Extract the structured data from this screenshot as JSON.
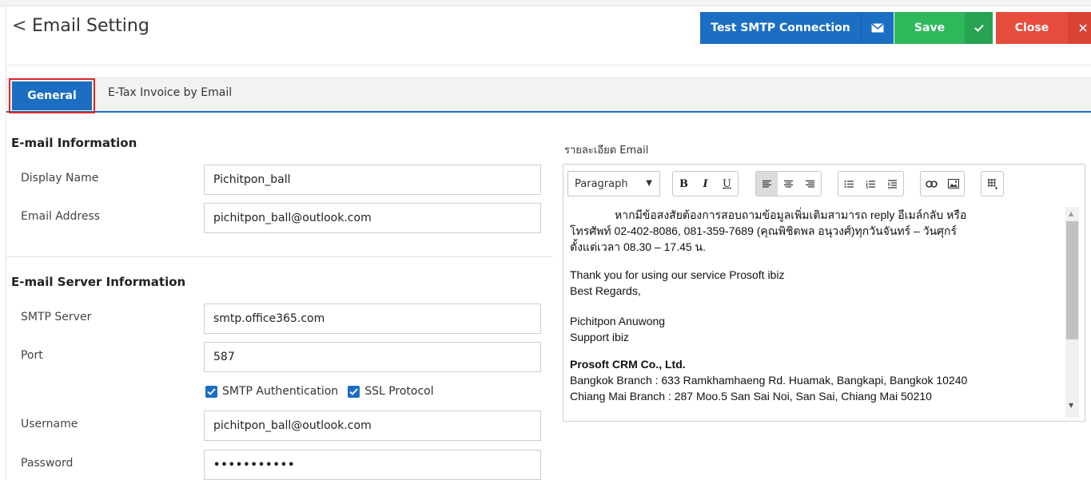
{
  "header": {
    "back_icon": "chevron-left-icon",
    "title": "Email Setting",
    "test_label": "Test SMTP Connection",
    "test_icon": "envelope-icon",
    "save_label": "Save",
    "save_icon": "checkmark-icon",
    "close_label": "Close",
    "close_icon": "close-x-icon",
    "colors": {
      "primary": "#1b6ec2",
      "save": "#2eb85c",
      "close": "#e74c3c"
    }
  },
  "tabs": [
    {
      "label": "General",
      "active": true
    },
    {
      "label": "E-Tax Invoice by Email",
      "active": false
    }
  ],
  "email_info": {
    "title": "E-mail Information",
    "display_name_label": "Display Name",
    "display_name_value": "Pichitpon_ball",
    "email_label": "Email Address",
    "email_value": "pichitpon_ball@outlook.com"
  },
  "server_info": {
    "title": "E-mail Server Information",
    "smtp_label": "SMTP Server",
    "smtp_value": "smtp.office365.com",
    "port_label": "Port",
    "port_value": "587",
    "smtp_auth_label": "SMTP Authentication",
    "smtp_auth_checked": true,
    "ssl_label": "SSL Protocol",
    "ssl_checked": true,
    "username_label": "Username",
    "username_value": "pichitpon_ball@outlook.com",
    "password_label": "Password",
    "password_value": "•••••••••••"
  },
  "editor": {
    "label": "รายละเอียด Email",
    "format_select": "Paragraph",
    "toolbar_icons": [
      "bold-icon",
      "italic-icon",
      "underline-icon",
      "align-left-icon",
      "align-center-icon",
      "align-right-icon",
      "bullet-list-icon",
      "numbered-list-icon",
      "indent-icon",
      "link-icon",
      "image-icon",
      "table-icon"
    ],
    "body": {
      "line1": "หากมีข้อสงสัยต้องการสอบถามข้อมูลเพิ่มเติมสามารถ reply อีเมล์กลับ หรือ",
      "line2": "โทรศัพท์ 02-402-8086, 081-359-7689 (คุณพิชิตพล อนุวงศ์)ทุกวันจันทร์ – วันศุกร์",
      "line3": "ตั้งแต่เวลา 08.30 – 17.45 น.",
      "thanks": "Thank you for using our service Prosoft ibiz",
      "regards": "Best Regards,",
      "name": "Pichitpon Anuwong",
      "role": "Support ibiz",
      "company": "Prosoft CRM Co., Ltd.",
      "branch1": "Bangkok Branch : 633 Ramkhamhaeng Rd. Huamak, Bangkapi, Bangkok 10240",
      "branch2": "Chiang Mai Branch : 287 Moo.5 San Sai Noi, San Sai, Chiang Mai 50210"
    }
  }
}
